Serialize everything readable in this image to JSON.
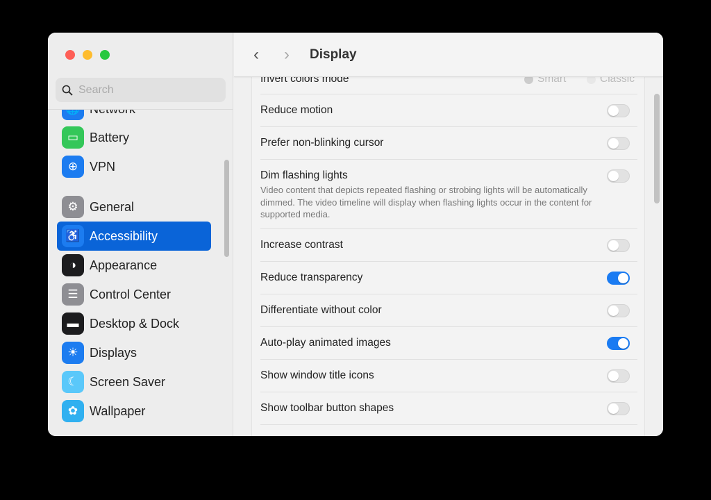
{
  "window": {
    "title": "Display"
  },
  "search": {
    "placeholder": "Search"
  },
  "sidebar": {
    "items": [
      {
        "label": "Network",
        "icon": "globe-icon",
        "color": "#1c7cf0"
      },
      {
        "label": "Battery",
        "icon": "battery-icon",
        "color": "#34c759"
      },
      {
        "label": "VPN",
        "icon": "vpn-globe-icon",
        "color": "#1c7cf0"
      },
      {
        "label": "General",
        "icon": "gear-icon",
        "color": "#8e8e93"
      },
      {
        "label": "Accessibility",
        "icon": "accessibility-icon",
        "color": "#1c7cf0",
        "selected": true
      },
      {
        "label": "Appearance",
        "icon": "appearance-icon",
        "color": "#1c1c1e"
      },
      {
        "label": "Control Center",
        "icon": "control-center-icon",
        "color": "#8e8e93"
      },
      {
        "label": "Desktop & Dock",
        "icon": "dock-icon",
        "color": "#1c1c1e"
      },
      {
        "label": "Displays",
        "icon": "sun-icon",
        "color": "#1c7cf0"
      },
      {
        "label": "Screen Saver",
        "icon": "screen-saver-icon",
        "color": "#5ac8fa"
      },
      {
        "label": "Wallpaper",
        "icon": "flower-icon",
        "color": "#30b0f0"
      }
    ]
  },
  "settings": {
    "invert": {
      "label": "Invert colors mode",
      "options": [
        "Smart",
        "Classic"
      ],
      "selected": "Smart"
    },
    "rows": [
      {
        "label": "Reduce motion",
        "on": false
      },
      {
        "label": "Prefer non-blinking cursor",
        "on": false
      },
      {
        "label": "Dim flashing lights",
        "on": false,
        "description": "Video content that depicts repeated flashing or strobing lights will be automatically dimmed. The video timeline will display when flashing lights occur in the content for supported media."
      },
      {
        "label": "Increase contrast",
        "on": false
      },
      {
        "label": "Reduce transparency",
        "on": true
      },
      {
        "label": "Differentiate without color",
        "on": false
      },
      {
        "label": "Auto-play animated images",
        "on": true
      },
      {
        "label": "Show window title icons",
        "on": false
      },
      {
        "label": "Show toolbar button shapes",
        "on": false
      }
    ]
  },
  "colors": {
    "accent": "#0a64d8",
    "toggle_on": "#1a7bf2"
  }
}
